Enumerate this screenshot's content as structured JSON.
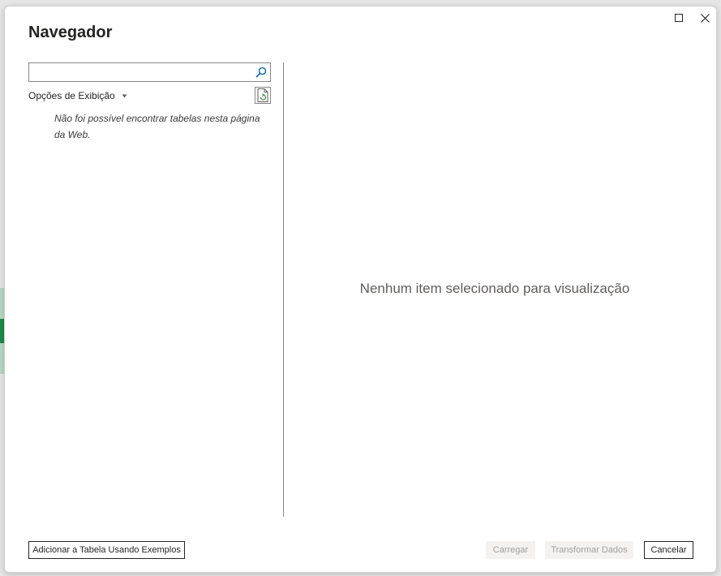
{
  "dialog": {
    "title": "Navegador",
    "maximize_icon": "maximize-icon",
    "close_icon": "close-icon"
  },
  "left_panel": {
    "search": {
      "value": "",
      "placeholder": "",
      "icon": "search-icon"
    },
    "display_options_label": "Opções de Exibição",
    "display_options_icon": "caret-down-icon",
    "refresh_icon": "refresh-page-icon",
    "message": "Não foi possível encontrar tabelas nesta página da Web."
  },
  "preview": {
    "empty_message": "Nenhum item selecionado para visualização"
  },
  "footer": {
    "add_table_label": "Adicionar a Tabela Usando Exemplos",
    "load_label": "Carregar",
    "transform_label": "Transformar Dados",
    "cancel_label": "Cancelar"
  },
  "colors": {
    "divider": "#8a8886",
    "disabled_bg": "#f3f2f1",
    "disabled_text": "#a19f9d",
    "search_icon": "#1f6fb5"
  }
}
